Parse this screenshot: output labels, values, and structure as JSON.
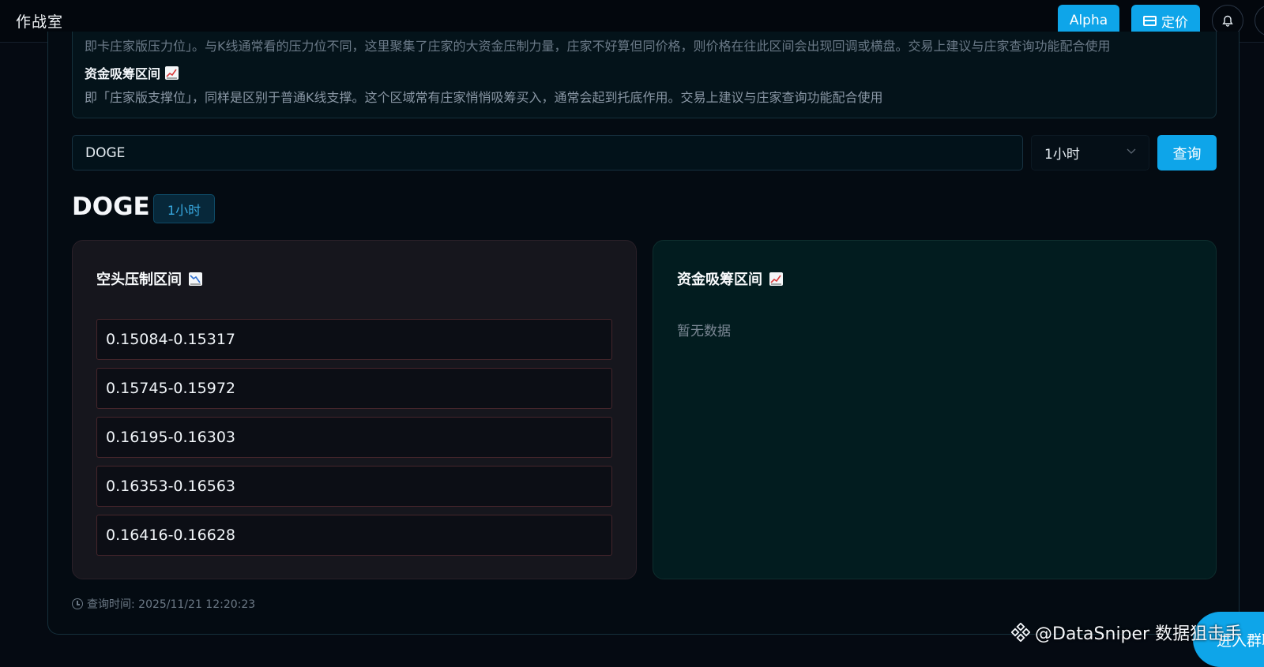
{
  "header": {
    "app_title": "作战室",
    "alpha_label": "Alpha",
    "pricing_label": "定价"
  },
  "info": {
    "clipped_text": "即卡庄家版压力位」。与K线通常看的压力位不同，这里聚集了庄家的大资金压制力量，庄家不好算但同价格，则价格在往此区间会出现回调或横盘。交易上建议与庄家查询功能配合使用",
    "accumulation_heading": "资金吸筹区间",
    "accumulation_text": "即「庄家版支撑位」，同样是区别于普通K线支撑。这个区域常有庄家悄悄吸筹买入，通常会起到托底作用。交易上建议与庄家查询功能配合使用"
  },
  "search": {
    "symbol_value": "DOGE",
    "timeframe_selected": "1小时",
    "query_label": "查询"
  },
  "result": {
    "symbol": "DOGE",
    "timeframe": "1小时",
    "short_zone": {
      "title": "空头压制区间",
      "ranges": [
        "0.15084-0.15317",
        "0.15745-0.15972",
        "0.16195-0.16303",
        "0.16353-0.16563",
        "0.16416-0.16628"
      ]
    },
    "long_zone": {
      "title": "资金吸筹区间",
      "empty_text": "暂无数据"
    },
    "query_time": "查询时间: 2025/11/21 12:20:23"
  },
  "watermark": {
    "text": "@DataSniper 数据狙击手"
  },
  "floating": {
    "label": "进入群聊"
  },
  "colors": {
    "accent": "#0ea5e9",
    "short_border": "#45252b",
    "long_bg": "#021c1f"
  },
  "icons": {
    "pricing": "credit-card-icon",
    "bell": "bell-icon",
    "chart_down": "chart-decreasing-icon",
    "chart_up": "chart-increasing-icon",
    "clock": "clock-icon",
    "chevron": "chevron-down-icon"
  }
}
